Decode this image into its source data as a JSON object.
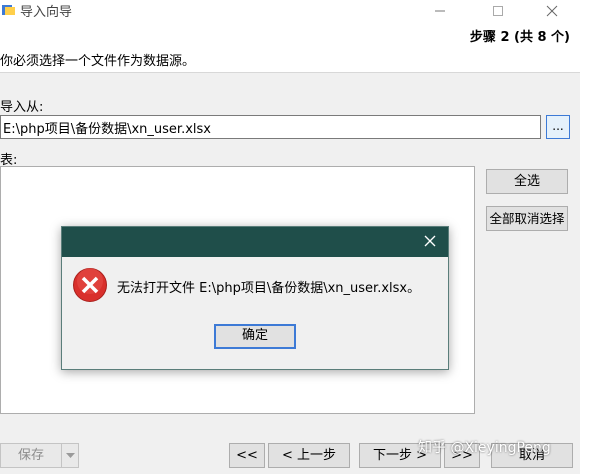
{
  "window": {
    "title": "导入向导",
    "step": "步骤 2 (共 8 个)",
    "instruction": "你必须选择一个文件作为数据源。",
    "import_from_label": "导入从:",
    "file_path": "E:\\php项目\\备份数据\\xn_user.xlsx",
    "browse_label": "...",
    "tables_label": "表:",
    "select_all": "全选",
    "deselect_all": "全部取消选择",
    "save": "保存",
    "first": "<<",
    "back": "< 上一步",
    "next": "下一步 >",
    "last": ">>",
    "cancel": "取消"
  },
  "dialog": {
    "message": "无法打开文件 E:\\php项目\\备份数据\\xn_user.xlsx。",
    "ok": "确定"
  },
  "watermark": "知乎 @XieyingPeng",
  "colors": {
    "dialog_title": "#1f4e4a",
    "error_red": "#d9302c",
    "focus_blue": "#3d7ad6"
  }
}
